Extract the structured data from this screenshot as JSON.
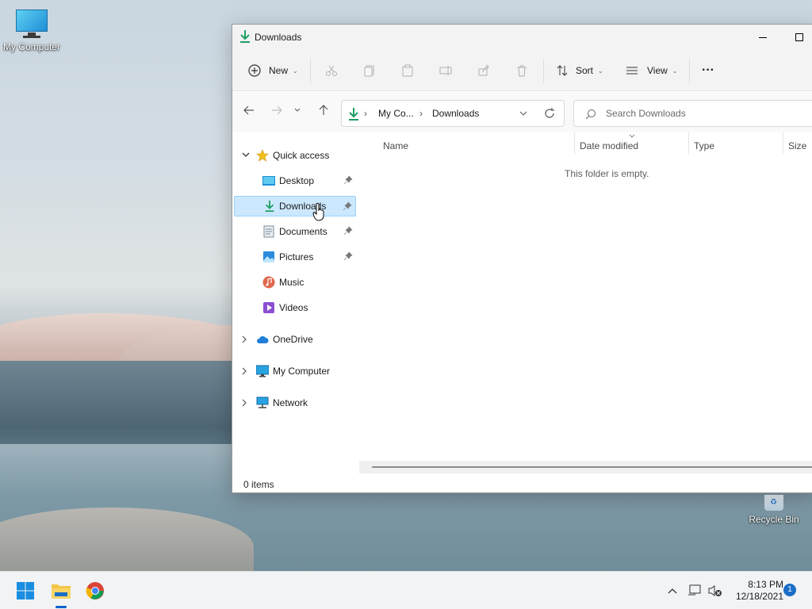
{
  "desktop": {
    "icons": [
      {
        "label": "My Computer"
      },
      {
        "label": "Recycle Bin"
      }
    ]
  },
  "window": {
    "title": "Downloads",
    "commands": {
      "new": "New",
      "sort": "Sort",
      "view": "View",
      "more": "···"
    },
    "address": {
      "crumbs": [
        "My Co...",
        "Downloads"
      ]
    },
    "search": {
      "placeholder": "Search Downloads"
    },
    "nav": {
      "quick_access": "Quick access",
      "items": [
        "Desktop",
        "Downloads",
        "Documents",
        "Pictures",
        "Music",
        "Videos"
      ],
      "onedrive": "OneDrive",
      "my_computer": "My Computer",
      "network": "Network"
    },
    "columns": [
      "Name",
      "Date modified",
      "Type",
      "Size"
    ],
    "empty_message": "This folder is empty.",
    "status": "0 items"
  },
  "taskbar": {
    "time": "8:13 PM",
    "date": "12/18/2021",
    "notifications": "1"
  },
  "colors": {
    "accent": "#0a62c9",
    "selection": "#cce8ff",
    "download_green": "#1e9e62"
  },
  "icons": [
    "download-icon",
    "cut-icon",
    "copy-icon",
    "paste-icon",
    "rename-icon",
    "share-icon",
    "delete-icon",
    "sort-icon",
    "view-icon",
    "refresh-icon",
    "search-icon",
    "pin-icon",
    "star-icon",
    "cloud-icon",
    "monitor-icon",
    "network-icon",
    "start-icon",
    "folder-icon",
    "chrome-icon"
  ]
}
